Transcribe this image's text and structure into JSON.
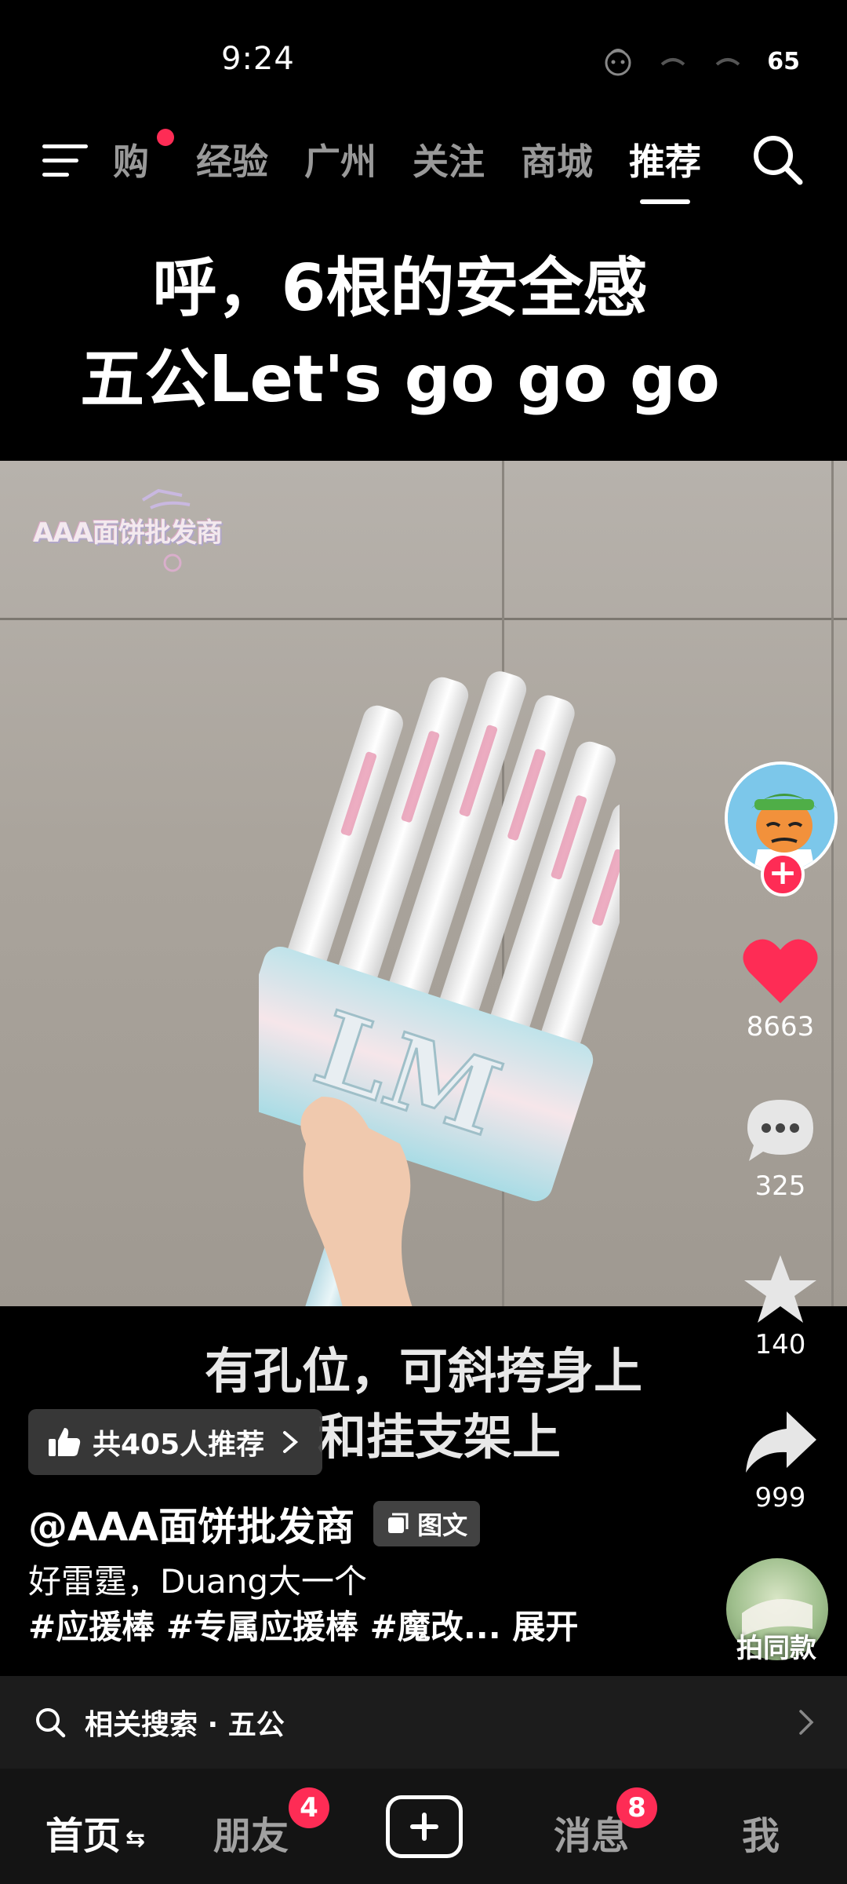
{
  "status_bar": {
    "time": "9:24",
    "battery": "65"
  },
  "top_nav": {
    "tabs": [
      {
        "label": "购",
        "active": false,
        "has_dot": true
      },
      {
        "label": "经验",
        "active": false
      },
      {
        "label": "广州",
        "active": false
      },
      {
        "label": "关注",
        "active": false
      },
      {
        "label": "商城",
        "active": false
      },
      {
        "label": "推荐",
        "active": true
      }
    ]
  },
  "video": {
    "headline_line1": "呼，6根的安全感",
    "headline_line2": "五公Let's go go go",
    "watermark": "AAA面饼批发商",
    "product_text": "LM",
    "subtitle_line1": "有孔位，可斜挎身上",
    "subtitle_line2": "和挂支架上"
  },
  "recommend": {
    "label": "共405人推荐"
  },
  "author": {
    "handle": "@AAA面饼批发商",
    "badge": "图文"
  },
  "description": {
    "text": "好雷霆，Duang大一个",
    "tags": "#应援棒 #专属应援棒 #魔改...",
    "expand": "展开"
  },
  "actions": {
    "likes": "8663",
    "comments": "325",
    "favorites": "140",
    "shares": "999",
    "same_style": "拍同款"
  },
  "related_search": {
    "label": "相关搜索 · 五公"
  },
  "tab_bar": {
    "home": "首页",
    "friends": "朋友",
    "friends_badge": "4",
    "messages": "消息",
    "messages_badge": "8",
    "me": "我"
  },
  "colors": {
    "accent": "#fe2c55",
    "background": "#000000"
  }
}
